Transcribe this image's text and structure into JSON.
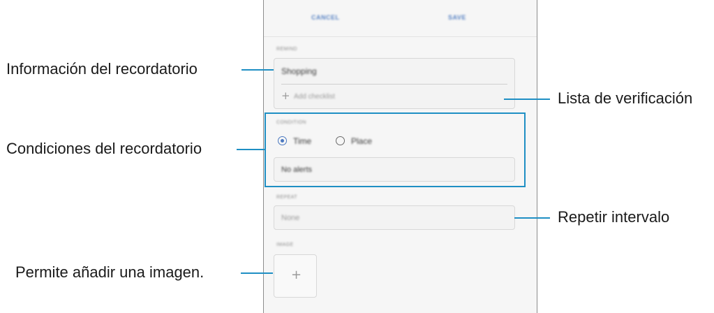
{
  "phone": {
    "topbar": {
      "cancel_label": "CANCEL",
      "save_label": "SAVE"
    },
    "reminder": {
      "section_label": "REMIND",
      "title_value": "Shopping",
      "checklist_label": "Add checklist"
    },
    "condition": {
      "section_label": "CONDITION",
      "options": [
        {
          "label": "Time",
          "selected": true
        },
        {
          "label": "Place",
          "selected": false
        }
      ],
      "alert_value": "No alerts"
    },
    "repeat": {
      "section_label": "REPEAT",
      "value": "None"
    },
    "image": {
      "section_label": "IMAGE",
      "add_symbol": "+"
    }
  },
  "callouts": {
    "reminder_info": "Información del recordatorio",
    "checklist": "Lista de verificación",
    "conditions": "Condiciones del recordatorio",
    "repeat": "Repetir intervalo",
    "image": "Permite añadir una imagen."
  },
  "accent_color": "#1f8fc4"
}
